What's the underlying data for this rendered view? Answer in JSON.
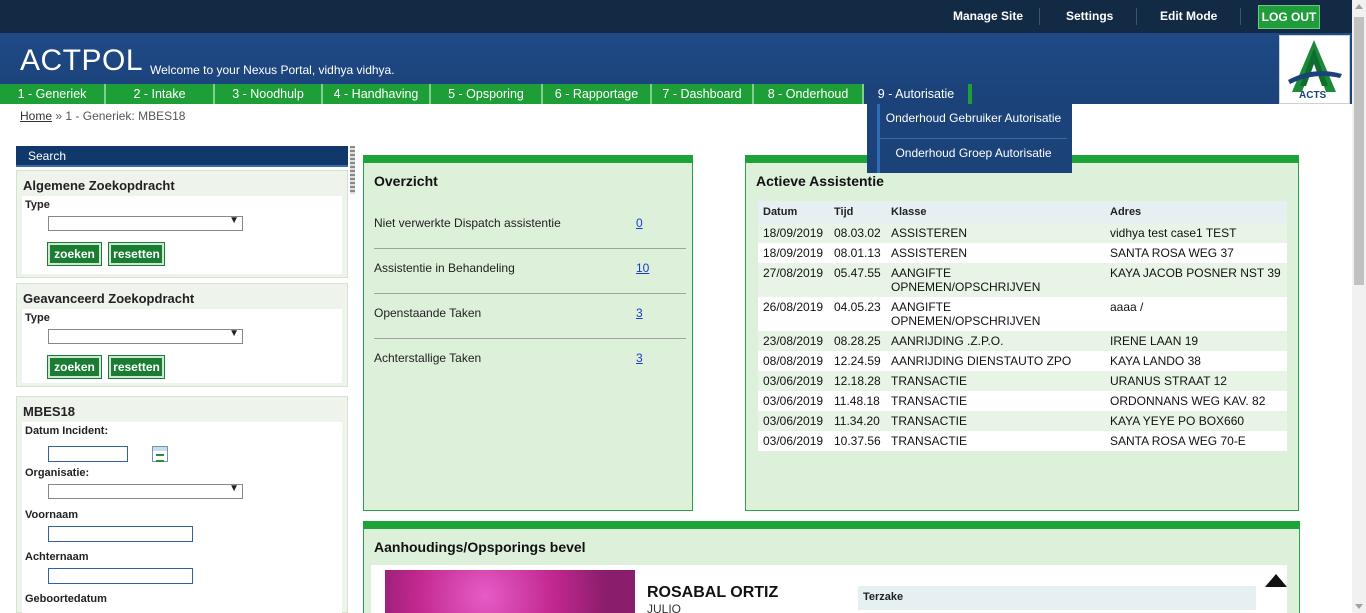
{
  "topbar": {
    "links": [
      "Manage Site",
      "Settings",
      "Edit Mode"
    ],
    "logout_label": "LOG OUT"
  },
  "header": {
    "title": "ACTPOL",
    "welcome": "Welcome to your Nexus Portal, vidhya vidhya.",
    "logo_text": "ACTS"
  },
  "nav": {
    "items": [
      "1 - Generiek",
      "2 - Intake",
      "3 - Noodhulp",
      "4 - Handhaving",
      "5 - Opsporing",
      "6 - Rapportage",
      "7 - Dashboard",
      "8 - Onderhoud",
      "9 - Autorisatie"
    ],
    "dropdown": [
      "Onderhoud Gebruiker Autorisatie",
      "Onderhoud Groep Autorisatie"
    ]
  },
  "breadcrumb": {
    "home": "Home",
    "separator": "»",
    "current": "1 - Generiek: MBES18"
  },
  "sidebar": {
    "search_header": "Search",
    "general": {
      "title": "Algemene Zoekopdracht",
      "type_label": "Type",
      "search_btn": "zoeken",
      "reset_btn": "resetten"
    },
    "advanced": {
      "title": "Geavanceerd Zoekopdracht",
      "type_label": "Type",
      "search_btn": "zoeken",
      "reset_btn": "resetten"
    },
    "mbes": {
      "title": "MBES18",
      "fields": [
        "Datum Incident:",
        "Organisatie:",
        "Voornaam",
        "Achternaam",
        "Geboortedatum"
      ]
    }
  },
  "overview": {
    "title": "Overzicht",
    "rows": [
      {
        "label": "Niet verwerkte Dispatch assistentie",
        "value": "0"
      },
      {
        "label": "Assistentie in Behandeling",
        "value": "10"
      },
      {
        "label": "Openstaande Taken",
        "value": "3"
      },
      {
        "label": "Achterstallige Taken",
        "value": "3"
      }
    ]
  },
  "active_assist": {
    "title": "Actieve Assistentie",
    "columns": [
      "Datum",
      "Tijd",
      "Klasse",
      "Adres"
    ],
    "rows": [
      [
        "18/09/2019",
        "08.03.02",
        "ASSISTEREN",
        "vidhya test case1  TEST"
      ],
      [
        "18/09/2019",
        "08.01.13",
        "ASSISTEREN",
        "SANTA ROSA WEG  37"
      ],
      [
        "27/08/2019",
        "05.47.55",
        "AANGIFTE OPNEMEN/OPSCHRIJVEN",
        "KAYA JACOB POSNER  NST 39"
      ],
      [
        "26/08/2019",
        "04.05.23",
        "AANGIFTE OPNEMEN/OPSCHRIJVEN",
        "aaaa  /"
      ],
      [
        "23/08/2019",
        "08.28.25",
        "AANRIJDING .Z.P.O.",
        "IRENE LAAN  19"
      ],
      [
        "08/08/2019",
        "12.24.59",
        "AANRIJDING DIENSTAUTO ZPO",
        "KAYA LANDO  38"
      ],
      [
        "03/06/2019",
        "12.18.28",
        "TRANSACTIE",
        "URANUS STRAAT  12"
      ],
      [
        "03/06/2019",
        "11.48.18",
        "TRANSACTIE",
        "ORDONNANS WEG  KAV. 82"
      ],
      [
        "03/06/2019",
        "11.34.20",
        "TRANSACTIE",
        "KAYA YEYE  PO BOX660"
      ],
      [
        "03/06/2019",
        "10.37.56",
        "TRANSACTIE",
        "SANTA ROSA WEG  70-E"
      ]
    ]
  },
  "warrant": {
    "title": "Aanhoudings/Opsporings bevel",
    "person_name": "ROSABAL ORTIZ",
    "person_sub": "JULIO",
    "terzake_label": "Terzake"
  }
}
